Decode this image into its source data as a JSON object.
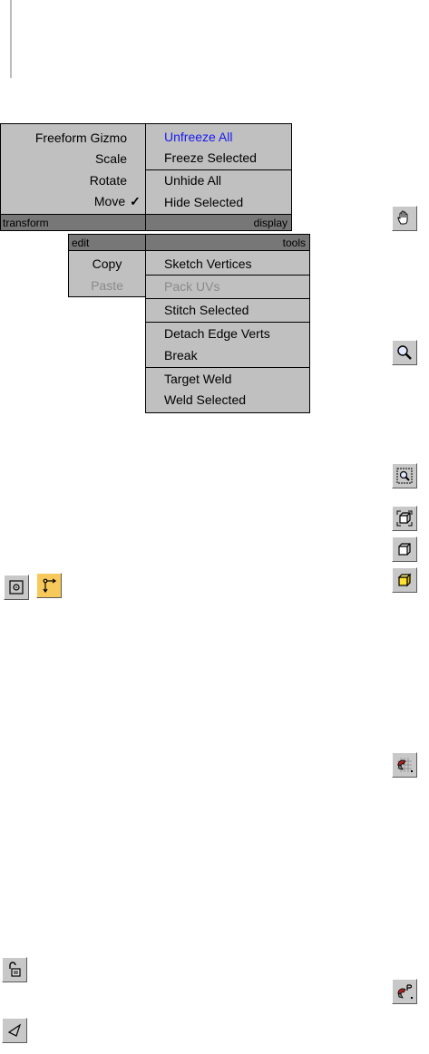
{
  "transform_menu": {
    "items": [
      "Freeform Gizmo",
      "Scale",
      "Rotate",
      "Move"
    ],
    "checked_item": "Move",
    "check_mark": "✓",
    "header_label": "transform"
  },
  "display_menu": {
    "items": [
      "Unfreeze All",
      "Freeze Selected",
      "Unhide All",
      "Hide Selected"
    ],
    "header_label": "display"
  },
  "edit_menu": {
    "header_label": "edit",
    "items": [
      "Copy",
      "Paste"
    ],
    "disabled_items": [
      "Paste"
    ]
  },
  "tools_menu": {
    "header_label": "tools",
    "items": [
      "Sketch Vertices",
      "Pack UVs",
      "Stitch Selected",
      "Detach Edge Verts",
      "Break",
      "Target Weld",
      "Weld Selected"
    ],
    "disabled_items": [
      "Pack UVs"
    ]
  },
  "colors": {
    "menu_bg": "#c0c0c0",
    "header_bg": "#777777",
    "highlight_text": "#1a1af0",
    "disabled_text": "#8a8a8a",
    "active_button": "#f7c95a"
  },
  "toolbar_icons": [
    "pan-hand-icon",
    "zoom-icon",
    "zoom-region-icon",
    "zoom-extents-icon",
    "zoom-extents-selected-icon",
    "zoom-extents-selected-active-icon",
    "grid-snap-magnet-icon",
    "pixel-snap-magnet-icon",
    "freeform-mode-icon",
    "move-mode-icon",
    "lock-selected-icon",
    "select-pointer-icon"
  ]
}
